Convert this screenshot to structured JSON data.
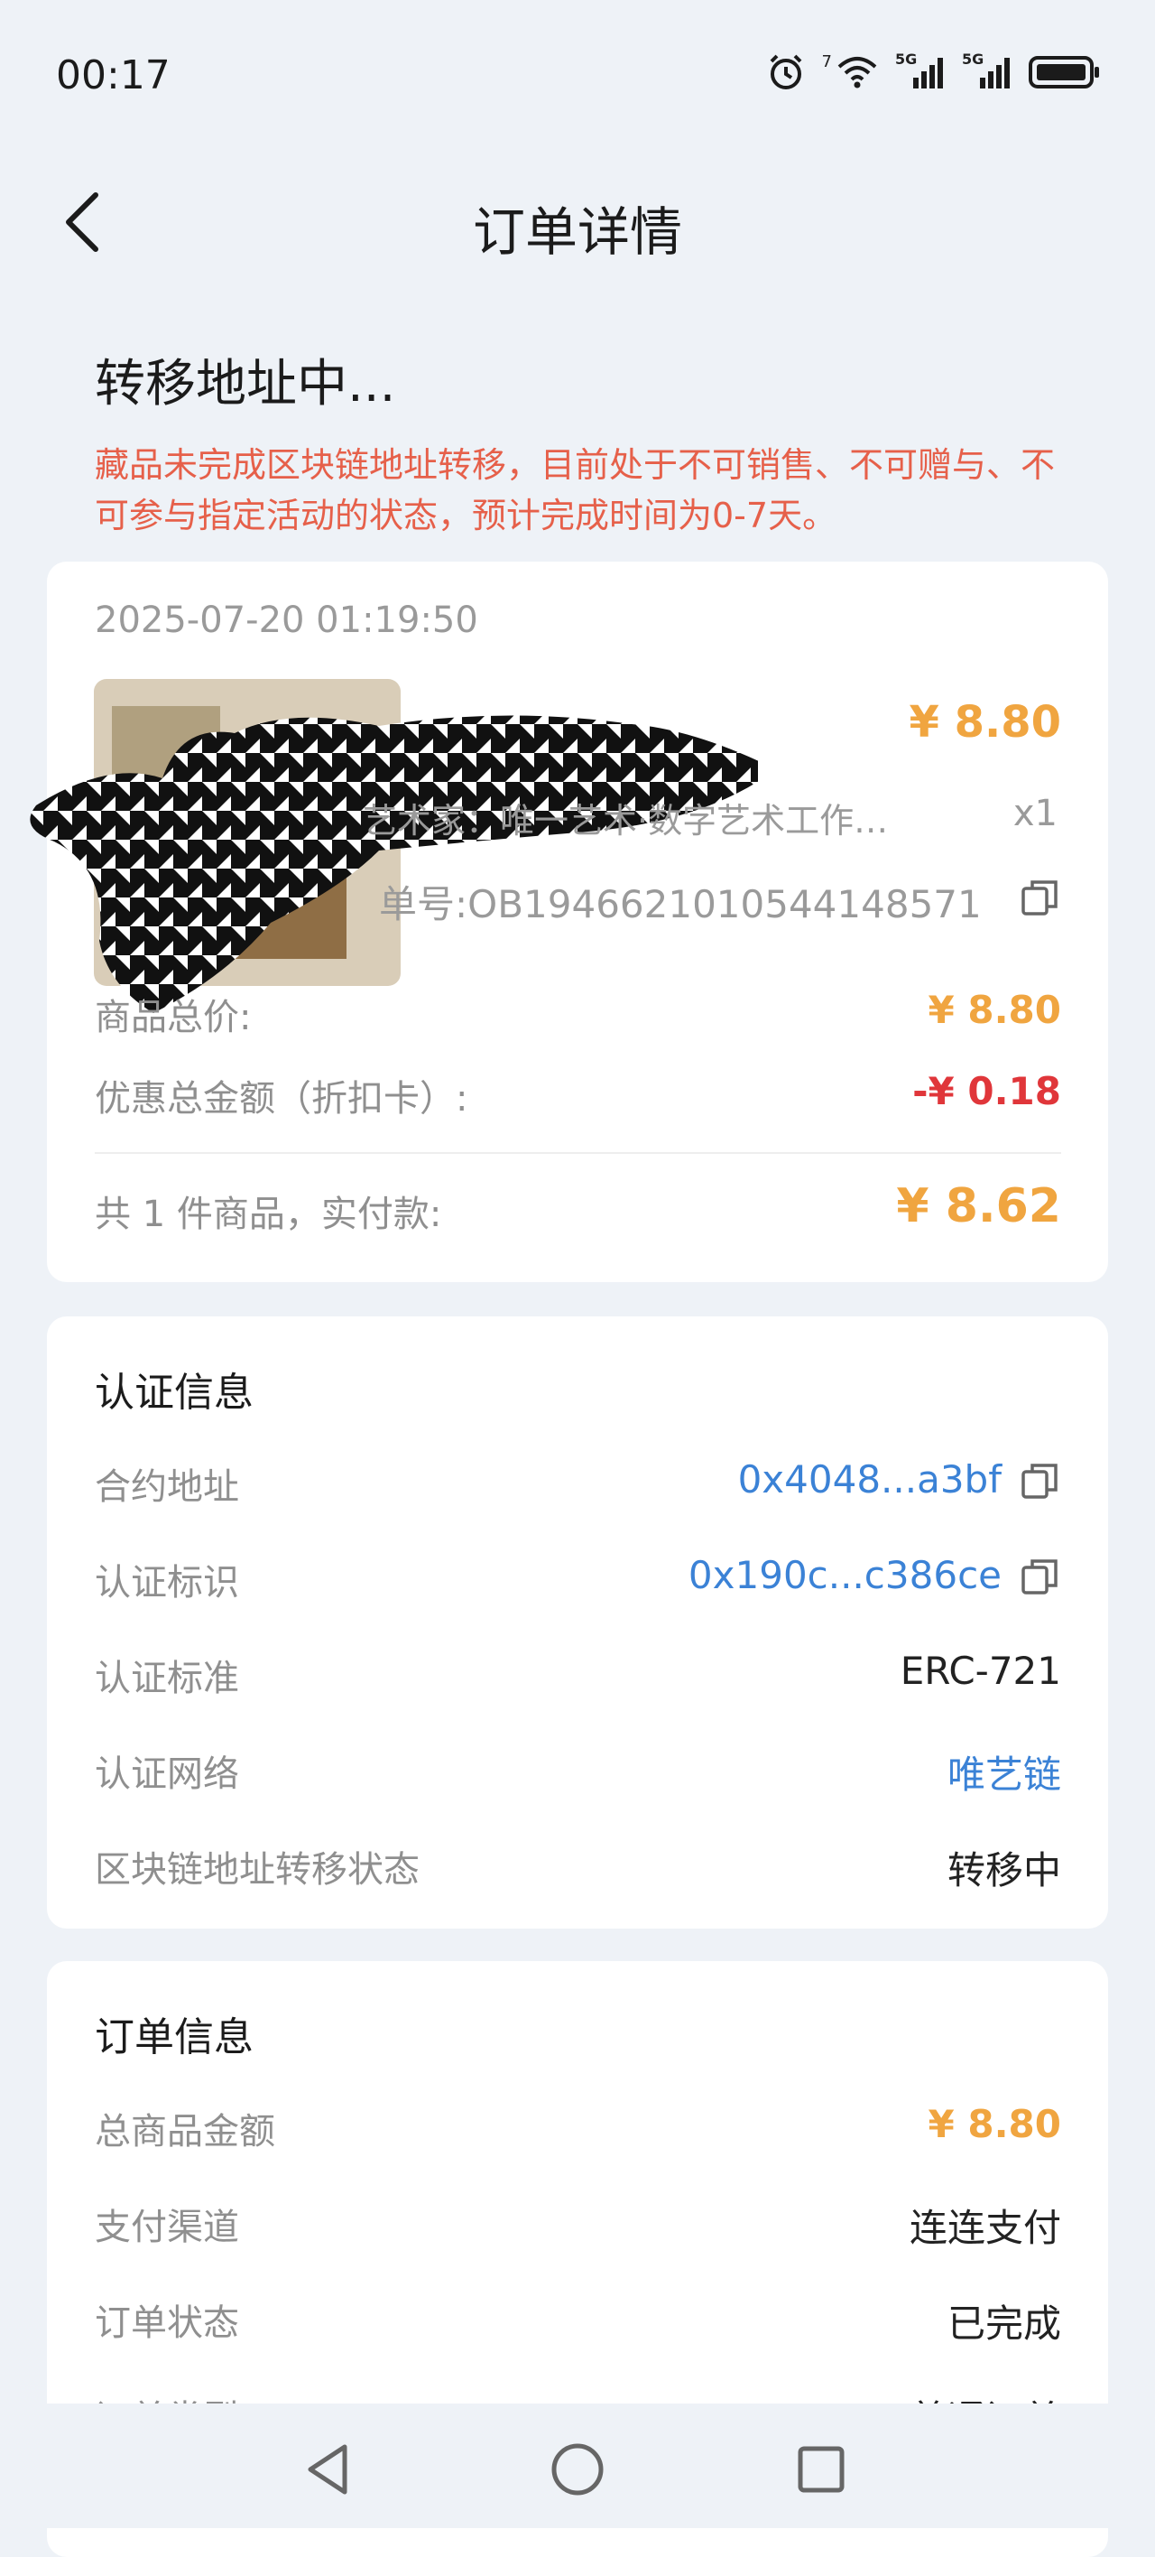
{
  "status": {
    "time": "00:17",
    "icons": [
      "alarm-icon",
      "wifi-icon",
      "signal-5g-1-icon",
      "signal-5g-2-icon",
      "battery-icon"
    ],
    "wifi_tag": "7",
    "net1": "5G",
    "net2": "5G"
  },
  "nav": {
    "title": "订单详情",
    "back_icon": "chevron-left-icon"
  },
  "banner": {
    "title": "转移地址中...",
    "desc": "藏品未完成区块链地址转移，目前处于不可销售、不可赠与、不可参与指定活动的状态，预计完成时间为0-7天。"
  },
  "order": {
    "time": "2025-07-20 01:19:50",
    "product_price": "¥ 8.80",
    "artist": "艺术家：唯一艺术·数字艺术工作…",
    "qty": "x1",
    "order_no": "单号:OB1946621010544148571",
    "total_label": "商品总价:",
    "total_value": "¥ 8.80",
    "discount_label": "优惠总金额（折扣卡）:",
    "discount_value": "-¥ 0.18",
    "paid_label": "共 1 件商品，实付款:",
    "paid_value": "¥ 8.62"
  },
  "auth": {
    "title": "认证信息",
    "rows": [
      {
        "label": "合约地址",
        "value": "0x4048...a3bf"
      },
      {
        "label": "认证标识",
        "value": "0x190c...c386ce"
      },
      {
        "label": "认证标准",
        "value": "ERC-721"
      },
      {
        "label": "认证网络",
        "value": "唯艺链"
      },
      {
        "label": "区块链地址转移状态",
        "value": "转移中"
      }
    ]
  },
  "order_info": {
    "title": "订单信息",
    "rows": [
      {
        "label": "总商品金额",
        "value": "¥ 8.80"
      },
      {
        "label": "支付渠道",
        "value": "连连支付"
      },
      {
        "label": "订单状态",
        "value": "已完成"
      },
      {
        "label": "订单类型",
        "value": "普通订单"
      }
    ]
  },
  "colors": {
    "accent_orange": "#f0a540",
    "danger_red": "#e0363a",
    "link_blue": "#3b82d6",
    "notice_red": "#e6604a",
    "page_bg": "#eef2f7"
  },
  "bottom_nav": {
    "icons": [
      "back-triangle-icon",
      "home-circle-icon",
      "recents-square-icon"
    ]
  }
}
